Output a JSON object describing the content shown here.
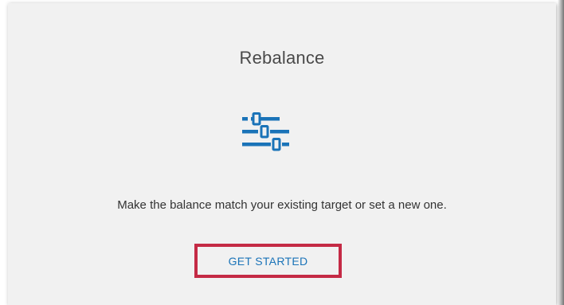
{
  "card": {
    "title": "Rebalance",
    "icon": "sliders-icon",
    "description": "Make the balance match your existing target or set a new one.",
    "button_label": "GET STARTED"
  },
  "colors": {
    "background": "#f1f1f1",
    "accent": "#1a73b8",
    "highlight_border": "#c42a45",
    "title_text": "#4a4a4a"
  }
}
